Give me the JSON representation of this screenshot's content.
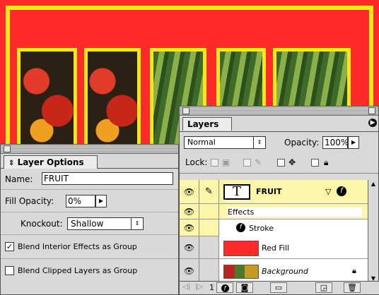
{
  "canvas": {
    "artwork_text": "FRUIT",
    "colors": {
      "background": "#ff2a2a",
      "stroke": "#f5e81a"
    }
  },
  "layers_panel": {
    "tab_label": "Layers",
    "blend_mode": "Normal",
    "opacity_label": "Opacity:",
    "opacity_value": "100%",
    "lock_label": "Lock:",
    "layers": [
      {
        "name": "FRUIT",
        "type": "text",
        "selected": true
      },
      {
        "name": "Effects",
        "type": "effects-header"
      },
      {
        "name": "Stroke",
        "type": "effect"
      },
      {
        "name": "Red Fill",
        "type": "fill"
      },
      {
        "name": "Background",
        "type": "background"
      }
    ],
    "footer_count": "1",
    "colors": {
      "selected_row": "#fbf6a8",
      "red_fill_swatch": "#ff2a2a"
    }
  },
  "layer_options_panel": {
    "tab_label": "Layer Options",
    "name_label": "Name:",
    "name_value": "FRUIT",
    "fill_opacity_label": "Fill Opacity:",
    "fill_opacity_value": "0%",
    "knockout_label": "Knockout:",
    "knockout_value": "Shallow",
    "blend_interior_label": "Blend Interior Effects as Group",
    "blend_interior_checked": true,
    "blend_clipped_label": "Blend Clipped Layers as Group",
    "blend_clipped_checked": false
  }
}
